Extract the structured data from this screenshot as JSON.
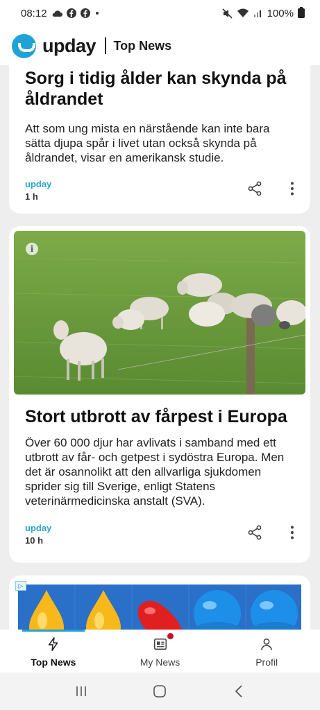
{
  "status": {
    "time": "08:12",
    "battery": "100%",
    "icons": [
      "cloud-icon",
      "facebook-icon",
      "facebook-icon",
      "dot-icon",
      "mute-icon",
      "wifi-icon",
      "signal-icon",
      "battery-icon"
    ]
  },
  "app": {
    "brand": "upday",
    "section": "Top News",
    "accent": "#1fa2d8"
  },
  "articles": [
    {
      "title": "Sorg i tidig ålder kan skynda på åldrandet",
      "summary": "Att som ung mista en närstående kan inte bara sätta djupa spår i livet utan också skynda på åldrandet, visar en amerikansk studie.",
      "source": "upday",
      "age": "1 h"
    },
    {
      "title": "Stort utbrott av fårpest i Europa",
      "summary": "Över 60 000 djur har avlivats i samband med ett utbrott av får- och getpest i sydöstra Europa. Men det är osannolikt att den allvarliga sjukdomen sprider sig till Sverige, enligt Statens veterinärmedicinska anstalt (SVA).",
      "source": "upday",
      "age": "10 h",
      "image": "sheep-grazing-photo"
    }
  ],
  "ad": {
    "badge": "▷",
    "image": "candy-game-banner"
  },
  "bottom_nav": [
    {
      "label": "Top News",
      "icon": "lightning-icon",
      "active": true
    },
    {
      "label": "My News",
      "icon": "news-card-icon",
      "active": false,
      "badge_dot": true
    },
    {
      "label": "Profil",
      "icon": "person-icon",
      "active": false
    }
  ],
  "system_nav": [
    "recent-apps-icon",
    "home-icon",
    "back-icon"
  ]
}
